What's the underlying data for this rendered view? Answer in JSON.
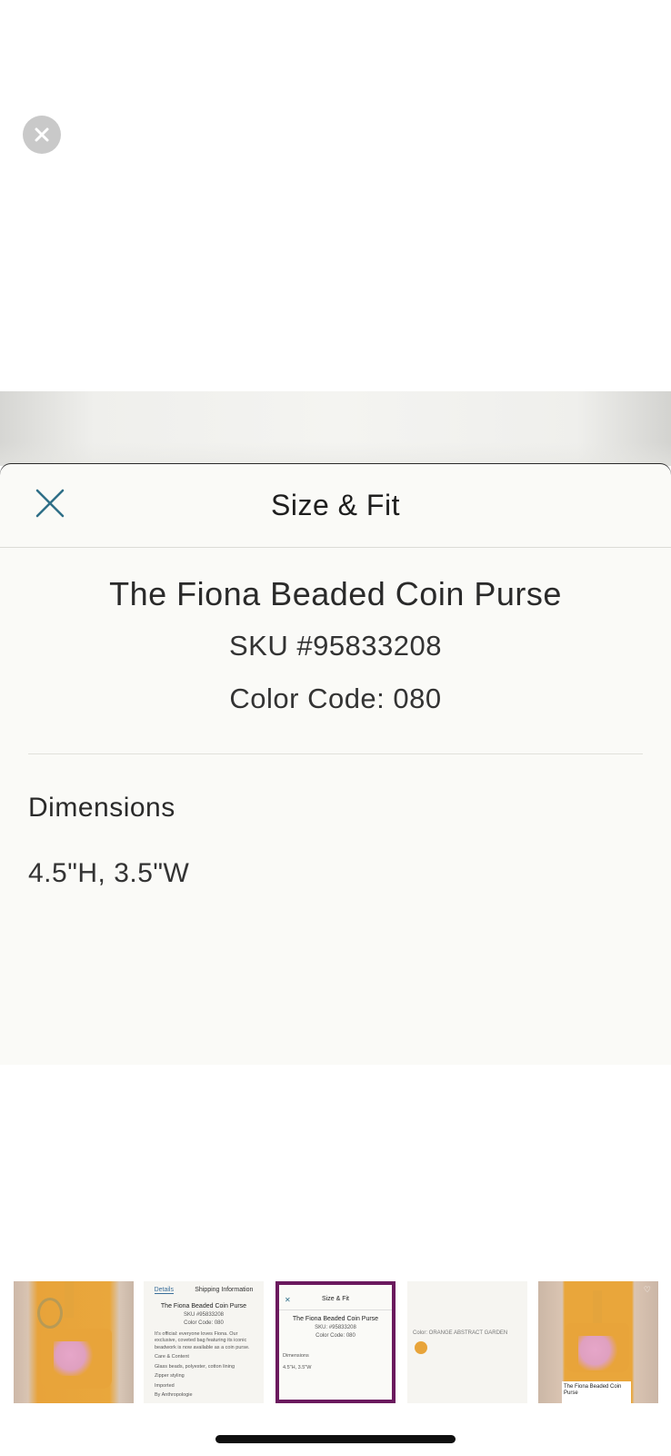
{
  "modal": {
    "title": "Size & Fit",
    "product_name": "The Fiona Beaded Coin Purse",
    "sku": "SKU #95833208",
    "color_code": "Color Code: 080",
    "dimensions_heading": "Dimensions",
    "dimensions_value": "4.5\"H, 3.5\"W"
  },
  "thumbnails": {
    "details": {
      "tab_details": "Details",
      "tab_shipping": "Shipping Information",
      "title": "The Fiona Beaded Coin Purse",
      "sku": "SKU #95833208",
      "color_code": "Color Code: 080",
      "description": "It's official: everyone loves Fiona. Our exclusive, coveted bag featuring its iconic beadwork is now available as a coin purse.",
      "care_heading": "Care & Content",
      "care_lines": [
        "Glass beads, polyester, cotton lining",
        "Zipper styling",
        "Imported"
      ],
      "brand": "By Anthropologie"
    },
    "size_fit": {
      "title": "Size & Fit",
      "product_name": "The Fiona Beaded Coin Purse",
      "sku": "SKU: #95833208",
      "color_code": "Color Code: 080",
      "dimensions_heading": "Dimensions",
      "dimensions_value": "4.5\"H, 3.5\"W"
    },
    "color": {
      "label": "Color: ORANGE ABSTRACT GARDEN"
    },
    "last": {
      "caption": "The Fiona Beaded Coin Purse"
    }
  },
  "icons": {
    "dismiss": "close-icon",
    "sheet_close": "close-icon"
  },
  "colors": {
    "accent_teal": "#2f6f88",
    "selected_border": "#6b1a5e",
    "sheet_bg": "#fafaf7"
  }
}
